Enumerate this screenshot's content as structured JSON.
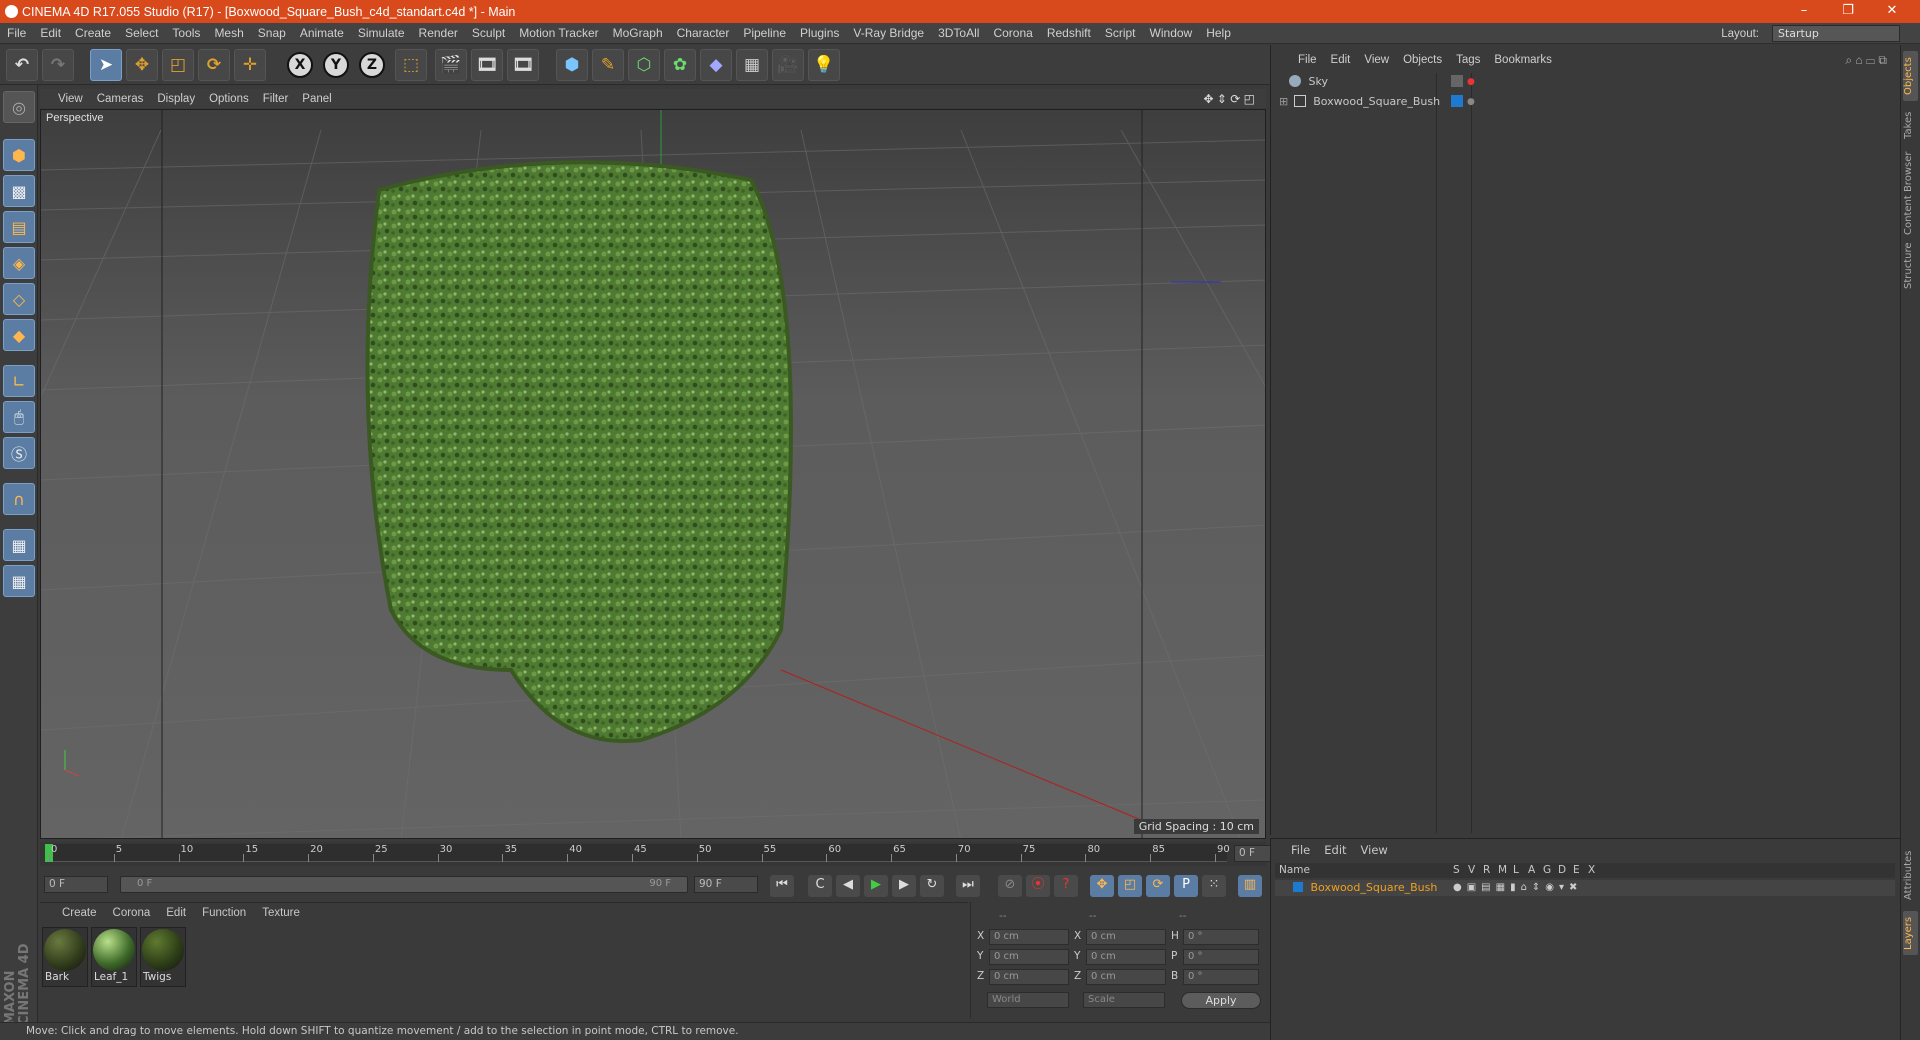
{
  "window": {
    "title": "CINEMA 4D R17.055 Studio (R17) - [Boxwood_Square_Bush_c4d_standart.c4d *] - Main",
    "minimize": "–",
    "restore": "❐",
    "close": "✕"
  },
  "menu": [
    "File",
    "Edit",
    "Create",
    "Select",
    "Tools",
    "Mesh",
    "Snap",
    "Animate",
    "Simulate",
    "Render",
    "Sculpt",
    "Motion Tracker",
    "MoGraph",
    "Character",
    "Pipeline",
    "Plugins",
    "V-Ray Bridge",
    "3DToAll",
    "Corona",
    "Redshift",
    "Script",
    "Window",
    "Help"
  ],
  "layout": {
    "label": "Layout:",
    "value": "Startup"
  },
  "toolbar": {
    "x": "X",
    "y": "Y",
    "z": "Z"
  },
  "viewport": {
    "menu": [
      "View",
      "Cameras",
      "Display",
      "Options",
      "Filter",
      "Panel"
    ],
    "label": "Perspective",
    "grid_spacing": "Grid Spacing : 10 cm"
  },
  "timeline": {
    "ticks": [
      "0",
      "5",
      "10",
      "15",
      "20",
      "25",
      "30",
      "35",
      "40",
      "45",
      "50",
      "55",
      "60",
      "65",
      "70",
      "75",
      "80",
      "85",
      "90"
    ],
    "current": "0 F",
    "start": "0 F",
    "range_start": "0 F",
    "range_end": "90 F",
    "end": "90 F"
  },
  "materials": {
    "menu": [
      "Create",
      "Corona",
      "Edit",
      "Function",
      "Texture"
    ],
    "items": [
      {
        "name": "Bark",
        "color": "#2f3a1a"
      },
      {
        "name": "Leaf_1",
        "color": "#3f6b2a"
      },
      {
        "name": "Twigs",
        "color": "#2b3b16"
      }
    ]
  },
  "coords": {
    "headers": [
      "--",
      "--",
      "--"
    ],
    "rows": [
      {
        "a": "X",
        "av": "0 cm",
        "b": "X",
        "bv": "0 cm",
        "c": "H",
        "cv": "0 °"
      },
      {
        "a": "Y",
        "av": "0 cm",
        "b": "Y",
        "bv": "0 cm",
        "c": "P",
        "cv": "0 °"
      },
      {
        "a": "Z",
        "av": "0 cm",
        "b": "Z",
        "bv": "0 cm",
        "c": "B",
        "cv": "0 °"
      }
    ],
    "mode1": "World",
    "mode2": "Scale",
    "apply": "Apply"
  },
  "objects": {
    "menu": [
      "File",
      "Edit",
      "View",
      "Objects",
      "Tags",
      "Bookmarks"
    ],
    "items": [
      {
        "name": "Sky"
      },
      {
        "name": "Boxwood_Square_Bush"
      }
    ]
  },
  "layers": {
    "menu": [
      "File",
      "Edit",
      "View"
    ],
    "header": "Name",
    "cols": [
      "S",
      "V",
      "R",
      "M",
      "L",
      "A",
      "G",
      "D",
      "E",
      "X"
    ],
    "row": "Boxwood_Square_Bush"
  },
  "right_tabs": [
    "Objects",
    "Takes",
    "Content Browser",
    "Structure",
    "Attributes",
    "Layers"
  ],
  "brand": "MAXON CINEMA 4D",
  "status": "Move: Click and drag to move elements. Hold down SHIFT to quantize movement / add to the selection in point mode, CTRL to remove.",
  "colors": {
    "title_bar": "#d84a1b",
    "accent": "#5b7da3",
    "layer_text": "#f0a020"
  }
}
